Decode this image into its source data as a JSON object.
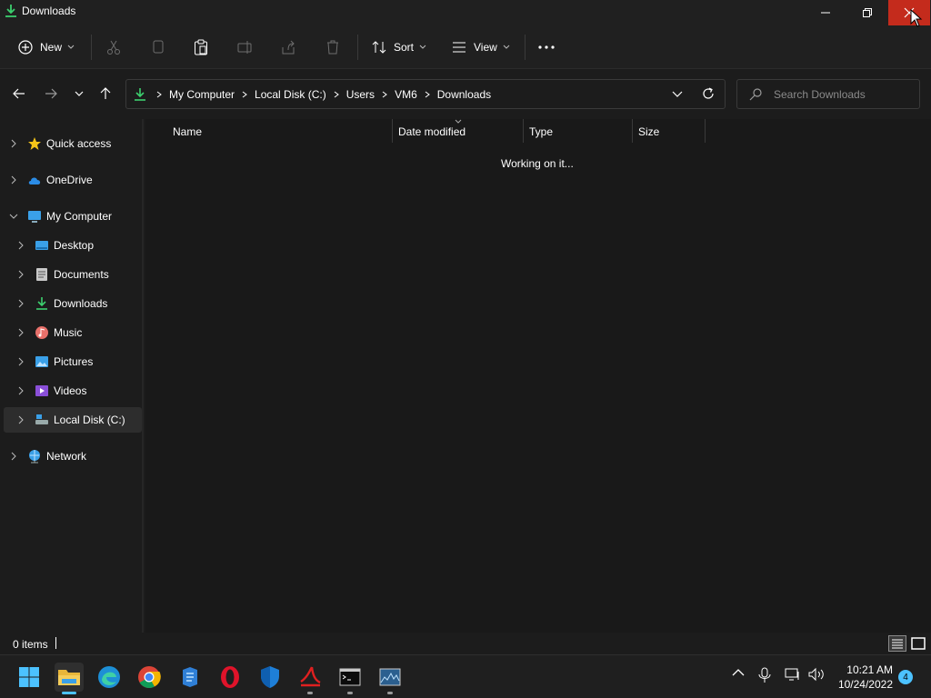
{
  "window": {
    "title": "Downloads"
  },
  "toolbar": {
    "new_label": "New",
    "sort_label": "Sort",
    "view_label": "View"
  },
  "address": {
    "crumbs": [
      "My Computer",
      "Local Disk (C:)",
      "Users",
      "VM6",
      "Downloads"
    ],
    "search_placeholder": "Search Downloads"
  },
  "sidebar": {
    "items": [
      {
        "label": "Quick access",
        "icon": "star-icon"
      },
      {
        "label": "OneDrive",
        "icon": "cloud-icon"
      },
      {
        "label": "My Computer",
        "icon": "computer-icon"
      },
      {
        "label": "Desktop",
        "icon": "desktop-icon"
      },
      {
        "label": "Documents",
        "icon": "documents-icon"
      },
      {
        "label": "Downloads",
        "icon": "download-icon"
      },
      {
        "label": "Music",
        "icon": "music-icon"
      },
      {
        "label": "Pictures",
        "icon": "pictures-icon"
      },
      {
        "label": "Videos",
        "icon": "videos-icon"
      },
      {
        "label": "Local Disk (C:)",
        "icon": "drive-icon"
      },
      {
        "label": "Network",
        "icon": "network-icon"
      }
    ]
  },
  "content": {
    "columns": [
      "Name",
      "Date modified",
      "Type",
      "Size"
    ],
    "status_message": "Working on it..."
  },
  "statusbar": {
    "item_count": "0 items"
  },
  "taskbar": {
    "apps": [
      "start-icon",
      "file-explorer-icon",
      "edge-icon",
      "chrome-icon",
      "app-icon",
      "opera-icon",
      "defender-icon",
      "pdf-icon",
      "terminal-icon",
      "monitor-icon"
    ],
    "time": "10:21 AM",
    "date": "10/24/2022",
    "notifications": "4"
  },
  "colors": {
    "accent": "#4cc2ff",
    "close_hover": "#c42b1c",
    "background": "#1c1c1c"
  }
}
